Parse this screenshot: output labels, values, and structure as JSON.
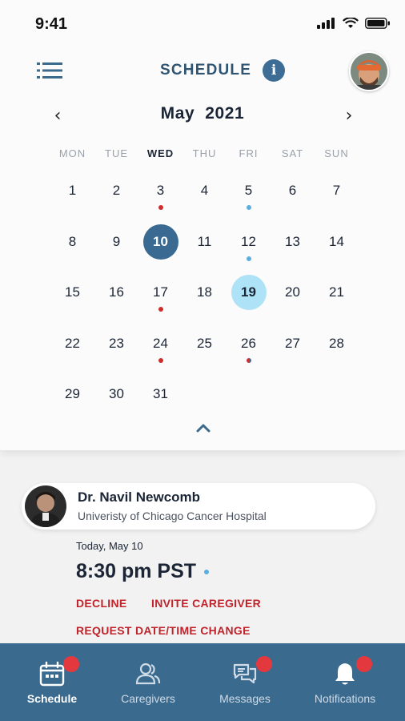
{
  "status_bar": {
    "time": "9:41"
  },
  "header": {
    "title": "SCHEDULE",
    "info_icon": "i"
  },
  "calendar": {
    "month": "May",
    "year": "2021",
    "weekdays": [
      "MON",
      "TUE",
      "WED",
      "THU",
      "FRI",
      "SAT",
      "SUN"
    ],
    "active_weekday_index": 2,
    "days": [
      {
        "n": "1"
      },
      {
        "n": "2"
      },
      {
        "n": "3",
        "dot": "red"
      },
      {
        "n": "4"
      },
      {
        "n": "5",
        "dot": "blue"
      },
      {
        "n": "6"
      },
      {
        "n": "7"
      },
      {
        "n": "8"
      },
      {
        "n": "9"
      },
      {
        "n": "10",
        "state": "selected"
      },
      {
        "n": "11"
      },
      {
        "n": "12",
        "dot": "blue"
      },
      {
        "n": "13"
      },
      {
        "n": "14"
      },
      {
        "n": "15"
      },
      {
        "n": "16"
      },
      {
        "n": "17",
        "dot": "red"
      },
      {
        "n": "18"
      },
      {
        "n": "19",
        "state": "today"
      },
      {
        "n": "20"
      },
      {
        "n": "21"
      },
      {
        "n": "22"
      },
      {
        "n": "23"
      },
      {
        "n": "24",
        "dot": "red"
      },
      {
        "n": "25"
      },
      {
        "n": "26",
        "dot": "split"
      },
      {
        "n": "27"
      },
      {
        "n": "28"
      },
      {
        "n": "29"
      },
      {
        "n": "30"
      },
      {
        "n": "31"
      }
    ]
  },
  "appointment": {
    "doctor_name": "Dr. Navil Newcomb",
    "hospital": "Univeristy of Chicago Cancer Hospital",
    "date": "Today, May 10",
    "time": "8:30 pm PST",
    "actions": {
      "decline": "DECLINE",
      "invite": "INVITE CAREGIVER",
      "reschedule": "REQUEST DATE/TIME CHANGE"
    }
  },
  "nav": {
    "schedule": "Schedule",
    "caregivers": "Caregivers",
    "messages": "Messages",
    "notifications": "Notifications"
  },
  "colors": {
    "primary": "#3b6a8f",
    "selected_day": "#3a6a92",
    "today_day": "#aee2f6",
    "alert": "#c0242a",
    "badge": "#e3393e"
  }
}
